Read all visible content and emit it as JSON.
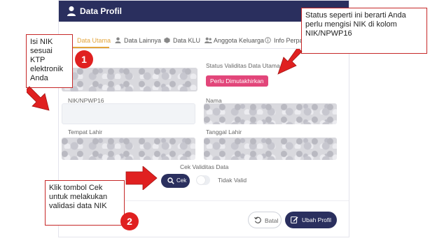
{
  "header": {
    "title": "Data Profil",
    "icon": "user-icon"
  },
  "tabs": [
    {
      "label": "Data Utama",
      "icon": "user-icon",
      "active": true
    },
    {
      "label": "Data Lainnya",
      "icon": "user-icon",
      "active": false
    },
    {
      "label": "Data KLU",
      "icon": "box-icon",
      "active": false
    },
    {
      "label": "Anggota Keluarga",
      "icon": "users-icon",
      "active": false
    },
    {
      "label": "Info Perpaja",
      "icon": "info-icon",
      "active": false
    }
  ],
  "form": {
    "status_label": "Status Validitas Data Utama",
    "status_badge": "Perlu Dimutakhirkan",
    "nik_label": "NIK/NPWP16",
    "nama_label": "Nama",
    "tempat_lahir_label": "Tempat Lahir",
    "tanggal_lahir_label": "Tanggal Lahir",
    "cek_validitas_label": "Cek Validitas Data",
    "cek_button": "Cek",
    "toggle_label": "Tidak Valid"
  },
  "footer": {
    "batal_button": "Batal",
    "ubah_button": "Ubah Profil"
  },
  "callouts": {
    "left": "Isi NIK sesuai KTP elektronik Anda",
    "right": "Status seperti ini berarti Anda perlu mengisi NIK di kolom NIK/NPWP16",
    "bottom": "Klik tombol Cek untuk melakukan validasi data NIK",
    "num1": "1",
    "num2": "2"
  },
  "colors": {
    "header": "#2a2f5e",
    "accent": "#e3a43a",
    "badge": "#e2467a",
    "annotation": "#e02020"
  }
}
